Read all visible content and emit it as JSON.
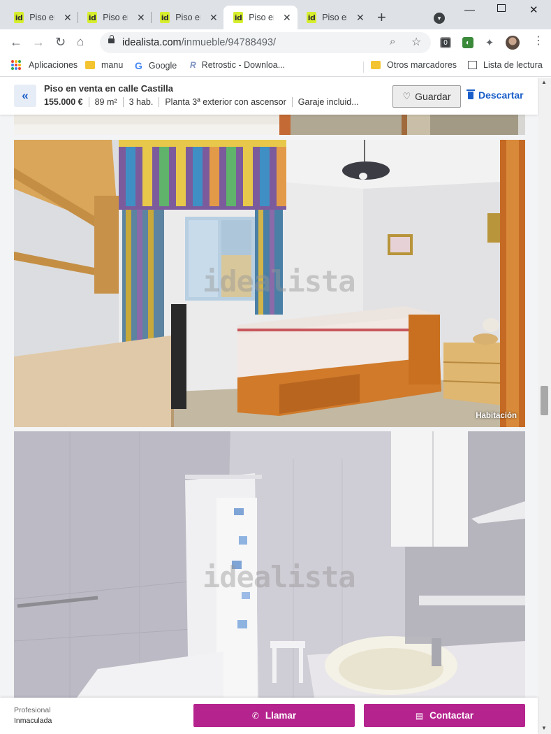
{
  "browser": {
    "tabs": [
      {
        "title": "Piso en venta en calle Castilla",
        "favicon": "id",
        "active": false
      },
      {
        "title": "Piso en venta en calle Castilla",
        "favicon": "id",
        "active": false
      },
      {
        "title": "Piso en venta en calle Castilla",
        "favicon": "id",
        "active": false
      },
      {
        "title": "Piso en venta en calle Castilla",
        "favicon": "id",
        "active": true
      },
      {
        "title": "Piso en venta en calle Castilla",
        "favicon": "id",
        "active": false
      }
    ],
    "tab_display": [
      "Piso en",
      "Piso en",
      "Piso en",
      "Piso en",
      "Piso en"
    ],
    "url_host": "idealista.com",
    "url_path": "/inmueble/94788493/",
    "bookmarks": [
      {
        "label": "Aplicaciones",
        "icon": "apps-grid-icon"
      },
      {
        "label": "manu",
        "icon": "folder-icon"
      },
      {
        "label": "Google",
        "icon": "google-icon"
      },
      {
        "label": "Retrostic - Downloa...",
        "icon": "retrostic-icon"
      },
      {
        "label": "Otros marcadores",
        "icon": "folder-icon"
      },
      {
        "label": "Lista de lectura",
        "icon": "reading-list-icon"
      }
    ]
  },
  "header": {
    "title": "Piso en venta en calle Castilla",
    "price": "155.000 €",
    "area": "89 m²",
    "rooms": "3 hab.",
    "floor": "Planta 3ª exterior con ascensor",
    "garage": "Garaje incluid...",
    "save_label": "Guardar",
    "discard_label": "Descartar"
  },
  "photos": [
    {
      "label": "",
      "room": "bedroom-partial"
    },
    {
      "label": "Habitación",
      "watermark": "idealista"
    },
    {
      "label": "",
      "watermark": "idealista"
    }
  ],
  "contact": {
    "advertiser_type": "Profesional",
    "advertiser_name": "Inmaculada",
    "call_label": "Llamar",
    "contact_label": "Contactar"
  },
  "colors": {
    "accent": "#b5248e",
    "link": "#1a5ec9",
    "favicon": "#d7ee2e"
  }
}
